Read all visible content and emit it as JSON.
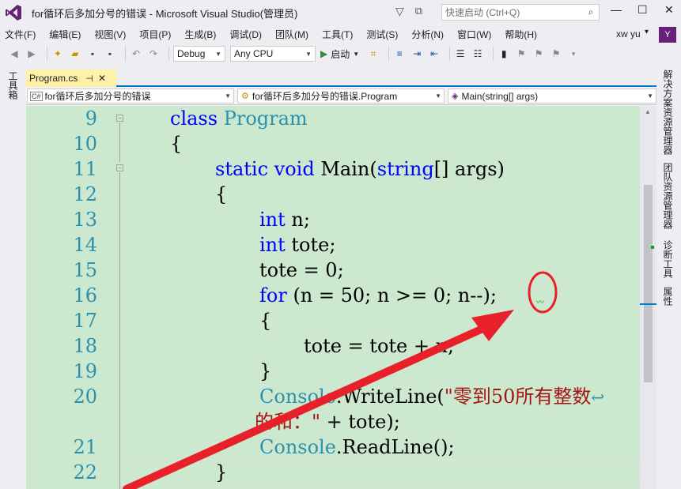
{
  "window": {
    "title": "for循环后多加分号的错误 - Microsoft Visual Studio(管理员)",
    "quick_launch_placeholder": "快速启动 (Ctrl+Q)"
  },
  "menu": {
    "items": [
      "文件(F)",
      "编辑(E)",
      "视图(V)",
      "项目(P)",
      "生成(B)",
      "调试(D)",
      "团队(M)",
      "工具(T)",
      "测试(S)",
      "分析(N)",
      "窗口(W)",
      "帮助(H)"
    ],
    "user": "xw yu",
    "account_initials": "Y"
  },
  "toolbar": {
    "config": "Debug",
    "platform": "Any CPU",
    "start_label": "启动"
  },
  "left_rail": {
    "label": "工具箱"
  },
  "right_rail": {
    "labels": [
      "解决方案资源管理器",
      "团队资源管理器",
      "诊断工具",
      "属性"
    ]
  },
  "tab": {
    "name": "Program.cs"
  },
  "navbar": {
    "project": "for循环后多加分号的错误",
    "class": "for循环后多加分号的错误.Program",
    "member": "Main(string[] args)"
  },
  "editor": {
    "line_numbers": [
      "9",
      "10",
      "11",
      "12",
      "13",
      "14",
      "15",
      "16",
      "17",
      "18",
      "19",
      "20",
      "21",
      "22"
    ],
    "lines": {
      "l9": {
        "kw": "class",
        "ty": "Program"
      },
      "l10": {
        "text": "{"
      },
      "l11": {
        "kw1": "static",
        "kw2": "void",
        "name": "Main(",
        "ty": "string",
        "rest": "[] args)"
      },
      "l12": {
        "text": "{"
      },
      "l13": {
        "kw": "int",
        "rest": " n;"
      },
      "l14": {
        "kw": "int",
        "rest": " tote;"
      },
      "l15": {
        "text": "tote = 0;"
      },
      "l16": {
        "kw": "for",
        "rest": " (n = 50; n >= 0; n--);"
      },
      "l17": {
        "text": "{"
      },
      "l18": {
        "text": "tote = tote + n;"
      },
      "l19": {
        "text": "}"
      },
      "l20": {
        "ty": "Console",
        "rest": ".WriteLine(",
        "str": "\"零到50所有整数",
        "wrap": "↩",
        "cont_str": "的和：\"",
        "cont_rest": " + tote);"
      },
      "l21": {
        "ty": "Console",
        "rest": ".ReadLine();"
      },
      "l22": {
        "text": "}"
      }
    }
  },
  "colors": {
    "editor_bg": "#cce8cf",
    "keyword": "#0000ff",
    "type": "#2b91af",
    "string": "#a31515",
    "annotation": "#e8202a",
    "accent": "#007acc",
    "vs_purple": "#68217a"
  }
}
